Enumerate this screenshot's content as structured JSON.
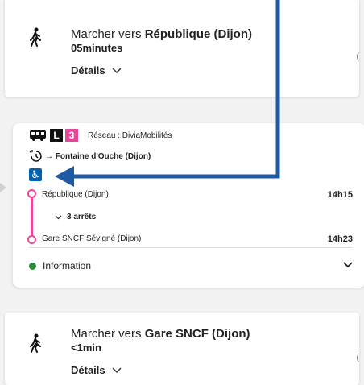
{
  "walk_step_1": {
    "prefix": "Marcher vers ",
    "destination": "République (Dijon)",
    "duration": "05minutes",
    "details_label": "Détails",
    "edge_char": "("
  },
  "transit_step": {
    "network_label": "Réseau : DiviaMobilités",
    "line_letter": "L",
    "line_number": "3",
    "direction": "→ Fontaine d'Ouche (Dijon)",
    "accessibility_symbol": "♿",
    "from_stop": "République (Dijon)",
    "from_time": "14h15",
    "stops_toggle": "3 arrêts",
    "to_stop": "Gare SNCF Sévigné (Dijon)",
    "to_time": "14h23",
    "info_label": "Information"
  },
  "walk_step_2": {
    "prefix": "Marcher vers ",
    "destination": "Gare SNCF (Dijon)",
    "duration": "<1min",
    "details_label": "Détails",
    "edge_char": "("
  },
  "colors": {
    "line_3": "#e6479b",
    "annotation_arrow": "#1f5aa6",
    "accessibility": "#0063b1",
    "info": "#2a8a3a"
  }
}
